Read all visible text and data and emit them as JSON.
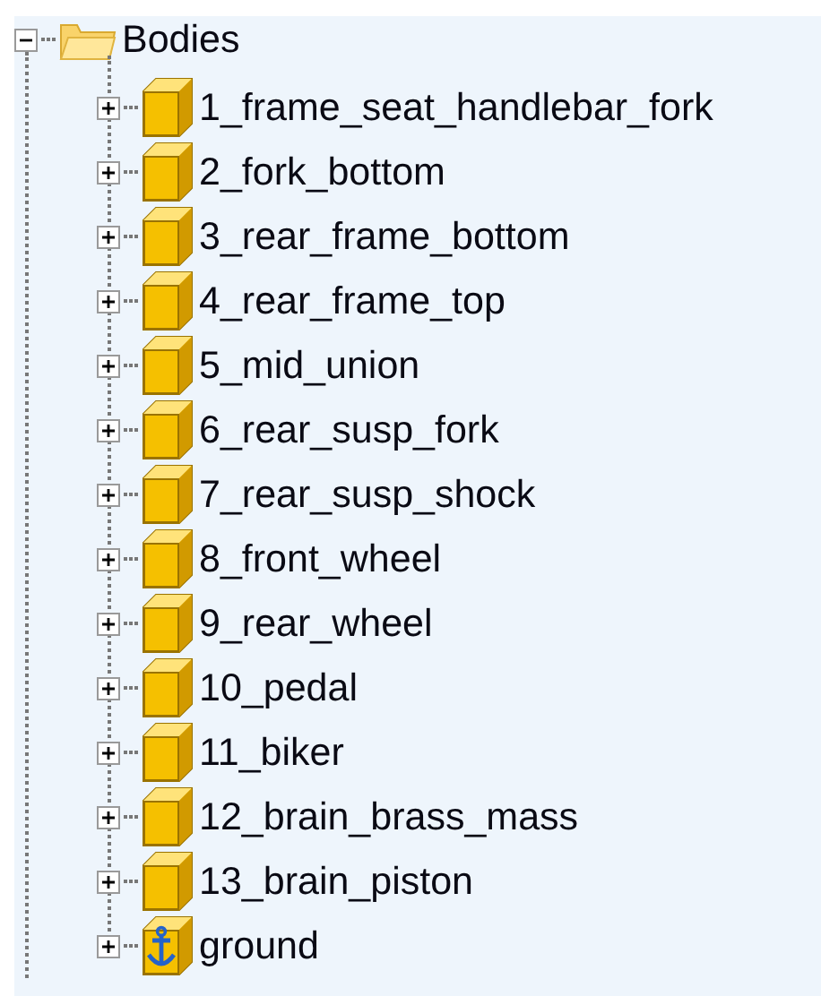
{
  "tree": [
    {
      "label": "Bodies",
      "kind": "folder",
      "expanded": true,
      "children": [
        {
          "label": "1_frame_seat_handlebar_fork",
          "kind": "body",
          "expanded": false
        },
        {
          "label": "2_fork_bottom",
          "kind": "body",
          "expanded": false
        },
        {
          "label": "3_rear_frame_bottom",
          "kind": "body",
          "expanded": false
        },
        {
          "label": "4_rear_frame_top",
          "kind": "body",
          "expanded": false
        },
        {
          "label": "5_mid_union",
          "kind": "body",
          "expanded": false
        },
        {
          "label": "6_rear_susp_fork",
          "kind": "body",
          "expanded": false
        },
        {
          "label": "7_rear_susp_shock",
          "kind": "body",
          "expanded": false
        },
        {
          "label": "8_front_wheel",
          "kind": "body",
          "expanded": false
        },
        {
          "label": "9_rear_wheel",
          "kind": "body",
          "expanded": false
        },
        {
          "label": "10_pedal",
          "kind": "body",
          "expanded": false
        },
        {
          "label": "11_biker",
          "kind": "body",
          "expanded": false
        },
        {
          "label": "12_brain_brass_mass",
          "kind": "body",
          "expanded": false
        },
        {
          "label": "13_brain_piston",
          "kind": "body",
          "expanded": false
        },
        {
          "label": "ground",
          "kind": "ground",
          "expanded": false
        }
      ]
    }
  ]
}
